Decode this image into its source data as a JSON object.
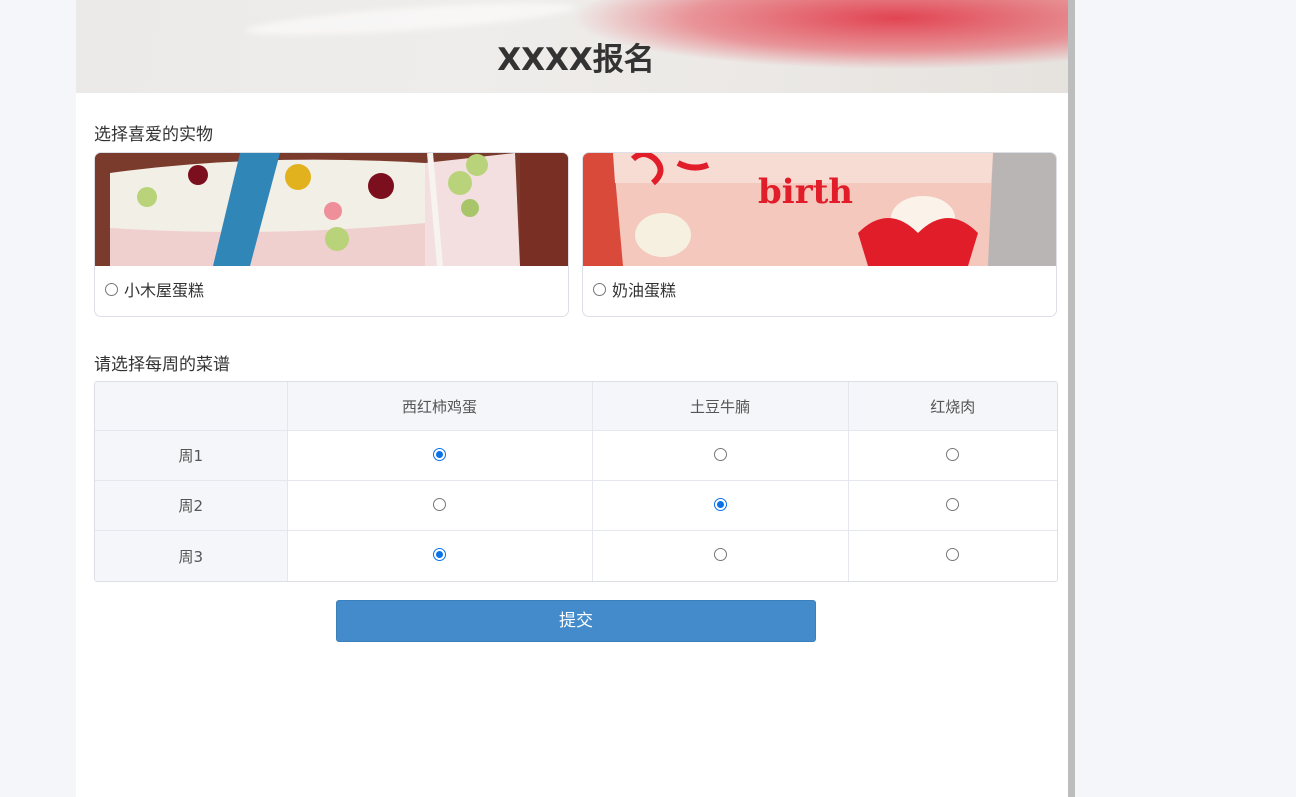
{
  "header": {
    "title": "XXXX报名"
  },
  "question1": {
    "label": "选择喜爱的实物",
    "options": [
      {
        "label": "小木屋蛋糕",
        "selected": false
      },
      {
        "label": "奶油蛋糕",
        "selected": false
      }
    ]
  },
  "question2": {
    "label": "请选择每周的菜谱",
    "columns": [
      "西红柿鸡蛋",
      "土豆牛腩",
      "红烧肉"
    ],
    "rows": [
      {
        "label": "周1",
        "selected_index": 0
      },
      {
        "label": "周2",
        "selected_index": 1
      },
      {
        "label": "周3",
        "selected_index": 0
      }
    ]
  },
  "submit": {
    "label": "提交"
  },
  "colors": {
    "accent": "#438bca",
    "radio_checked": "#0a72e8",
    "page_bg": "#f5f6fa"
  }
}
